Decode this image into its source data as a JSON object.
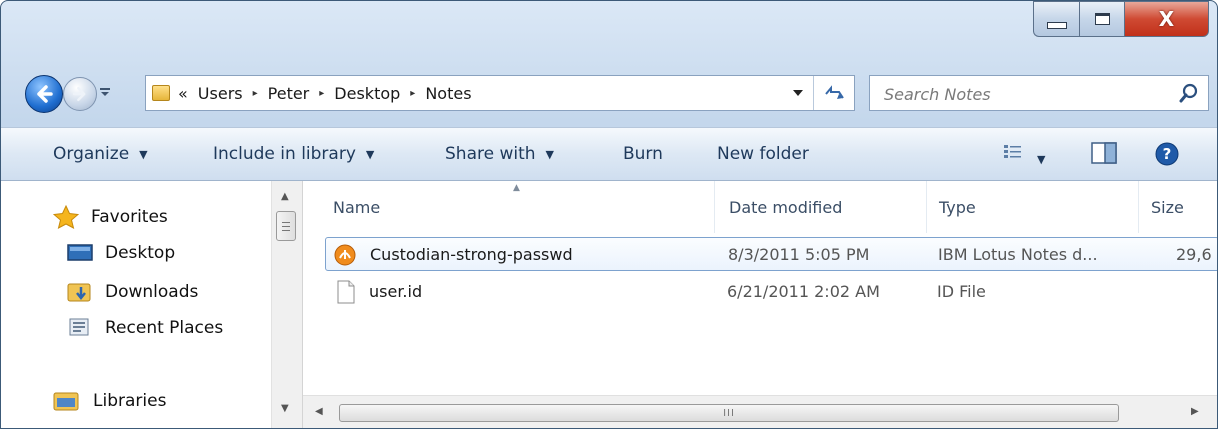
{
  "window": {
    "minimize_glyph": "—",
    "close_glyph": "X"
  },
  "address": {
    "overflow": "«",
    "crumbs": [
      "Users",
      "Peter",
      "Desktop",
      "Notes"
    ],
    "separator": "▸"
  },
  "search": {
    "placeholder": "Search Notes"
  },
  "toolbar": {
    "organize": "Organize",
    "include": "Include in library",
    "share": "Share with",
    "burn": "Burn",
    "new_folder": "New folder"
  },
  "nav": {
    "favorites": "Favorites",
    "desktop": "Desktop",
    "downloads": "Downloads",
    "recent": "Recent Places",
    "libraries": "Libraries"
  },
  "columns": {
    "name": "Name",
    "date": "Date modified",
    "type": "Type",
    "size": "Size"
  },
  "files": [
    {
      "name": "Custodian-strong-passwd",
      "date": "8/3/2011 5:05 PM",
      "type": "IBM Lotus Notes d...",
      "size": "29,6",
      "icon": "lotus-notes-icon"
    },
    {
      "name": "user.id",
      "date": "6/21/2011 2:02 AM",
      "type": "ID File",
      "size": "",
      "icon": "file-icon"
    }
  ],
  "scroll": {
    "grip": "III"
  },
  "colors": {
    "toolbar_text": "#1e395b",
    "selection_border": "#7da2ce",
    "frame": "#c4d7ec"
  }
}
